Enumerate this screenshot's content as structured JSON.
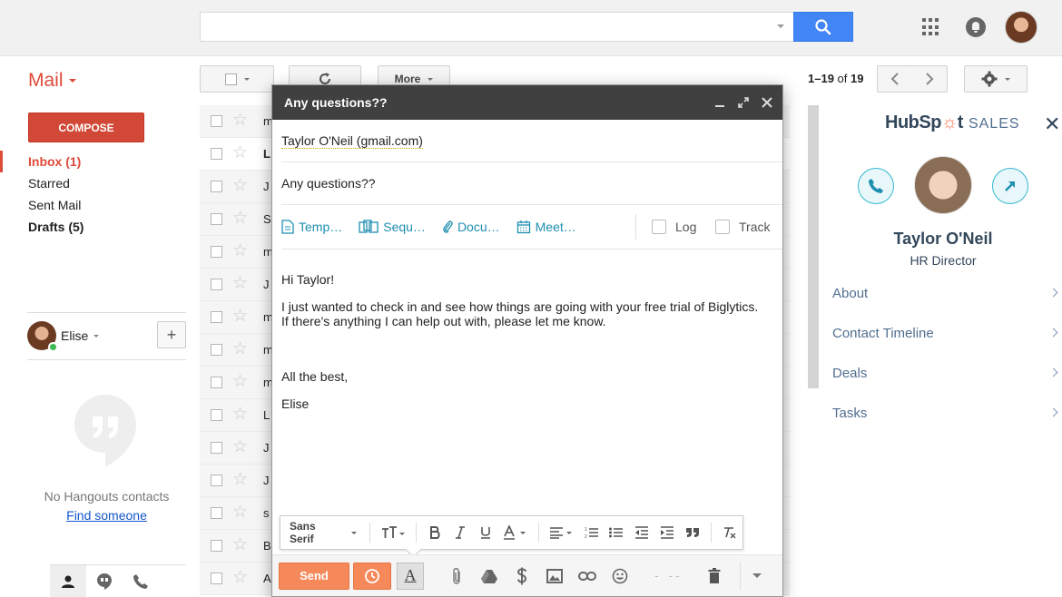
{
  "header": {
    "search_value": "",
    "icons": [
      "search-icon",
      "apps-icon",
      "notifications-icon",
      "account-avatar"
    ]
  },
  "sidebar": {
    "mail_label": "Mail",
    "compose_label": "COMPOSE",
    "nav": [
      {
        "label": "Inbox (1)",
        "state": "active"
      },
      {
        "label": "Starred",
        "state": "normal"
      },
      {
        "label": "Sent Mail",
        "state": "normal"
      },
      {
        "label": "Drafts (5)",
        "state": "bold"
      }
    ],
    "hangouts": {
      "user_name": "Elise",
      "add_label": "+",
      "empty_text": "No Hangouts contacts",
      "find_link": "Find someone"
    }
  },
  "toolbar": {
    "more_label": "More",
    "pager": {
      "range": "1–19",
      "of": "of",
      "total": "19"
    }
  },
  "email_list": {
    "senders": [
      "m",
      "L",
      "J",
      "S",
      "m",
      "J",
      "m",
      "m",
      "m",
      "L",
      "J",
      "J",
      "s",
      "B",
      "A"
    ],
    "unread_index": 1
  },
  "compose": {
    "title": "Any questions??",
    "to": "Taylor O'Neil (gmail.com)",
    "subject": "Any questions??",
    "tools": {
      "templates": "Temp…",
      "sequences": "Sequ…",
      "documents": "Docu…",
      "meetings": "Meet…",
      "log": "Log",
      "track": "Track"
    },
    "body": {
      "greeting": "Hi Taylor!",
      "line1": "I just wanted to check in and see how things are going with your free trial of Biglytics.",
      "line2": "If there's anything I can help out with, please let me know.",
      "closing": "All the best,",
      "signature": "Elise"
    },
    "format": {
      "font": "Sans Serif"
    },
    "send_label": "Send"
  },
  "hubspot": {
    "logo_hub": "HubSp",
    "logo_t": "t",
    "logo_sales": "SALES",
    "contact_name": "Taylor O'Neil",
    "contact_title": "HR Director",
    "sections": [
      "About",
      "Contact Timeline",
      "Deals",
      "Tasks"
    ],
    "accent_color": "#33b8cf",
    "brand_color": "#ff7a59"
  }
}
